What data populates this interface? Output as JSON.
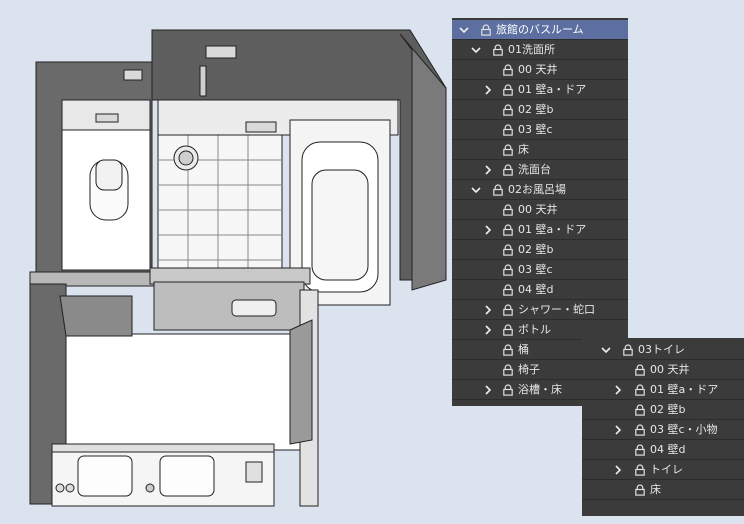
{
  "layers_panel": {
    "items": [
      {
        "label": "旅館のバスルーム",
        "level": 0,
        "chevron": "down",
        "selected": true
      },
      {
        "label": "01洗面所",
        "level": 1,
        "chevron": "down"
      },
      {
        "label": "00 天井",
        "level": 2,
        "chevron": "none"
      },
      {
        "label": "01 壁a・ドア",
        "level": 2,
        "chevron": "right"
      },
      {
        "label": "02 壁b",
        "level": 2,
        "chevron": "none"
      },
      {
        "label": "03 壁c",
        "level": 2,
        "chevron": "none"
      },
      {
        "label": "床",
        "level": 2,
        "chevron": "none"
      },
      {
        "label": "洗面台",
        "level": 2,
        "chevron": "right"
      },
      {
        "label": "02お風呂場",
        "level": 1,
        "chevron": "down"
      },
      {
        "label": "00 天井",
        "level": 2,
        "chevron": "none"
      },
      {
        "label": "01 壁a・ドア",
        "level": 2,
        "chevron": "right"
      },
      {
        "label": "02 壁b",
        "level": 2,
        "chevron": "none"
      },
      {
        "label": "03 壁c",
        "level": 2,
        "chevron": "none"
      },
      {
        "label": "04 壁d",
        "level": 2,
        "chevron": "none"
      },
      {
        "label": "シャワー・蛇口",
        "level": 2,
        "chevron": "right"
      },
      {
        "label": "ボトル",
        "level": 2,
        "chevron": "right"
      },
      {
        "label": "桶",
        "level": 2,
        "chevron": "none"
      },
      {
        "label": "椅子",
        "level": 2,
        "chevron": "none"
      },
      {
        "label": "浴槽・床",
        "level": 2,
        "chevron": "right"
      }
    ]
  },
  "toilet_panel": {
    "items": [
      {
        "label": "03トイレ",
        "level": 1,
        "chevron": "down"
      },
      {
        "label": "00 天井",
        "level": 2,
        "chevron": "none"
      },
      {
        "label": "01 壁a・ドア",
        "level": 2,
        "chevron": "right"
      },
      {
        "label": "02 壁b",
        "level": 2,
        "chevron": "none"
      },
      {
        "label": "03 壁c・小物",
        "level": 2,
        "chevron": "right"
      },
      {
        "label": "04 壁d",
        "level": 2,
        "chevron": "none"
      },
      {
        "label": "トイレ",
        "level": 2,
        "chevron": "right"
      },
      {
        "label": "床",
        "level": 2,
        "chevron": "none"
      }
    ]
  }
}
